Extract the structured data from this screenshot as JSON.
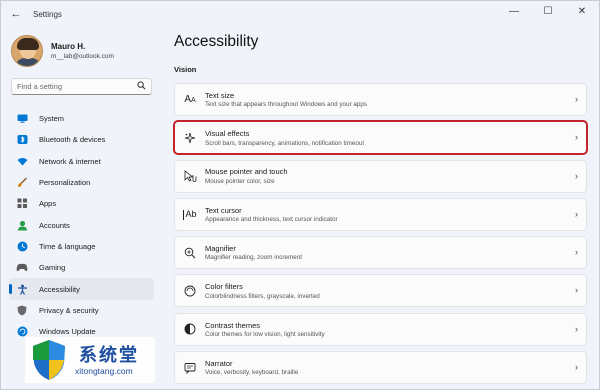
{
  "window": {
    "title": "Settings",
    "controls": [
      "minimize",
      "maximize",
      "close"
    ]
  },
  "profile": {
    "name": "Mauro H.",
    "email": "m__lab@outlook.com"
  },
  "search": {
    "placeholder": "Find a setting"
  },
  "sidebar": {
    "items": [
      {
        "label": "System",
        "icon": "system-icon",
        "color": "#0078d4",
        "active": false
      },
      {
        "label": "Bluetooth & devices",
        "icon": "bluetooth-icon",
        "color": "#0078d4",
        "active": false
      },
      {
        "label": "Network & internet",
        "icon": "network-icon",
        "color": "#0078d4",
        "active": false
      },
      {
        "label": "Personalization",
        "icon": "brush-icon",
        "color": "#d47a00",
        "active": false
      },
      {
        "label": "Apps",
        "icon": "apps-icon",
        "color": "#5b5b5b",
        "active": false
      },
      {
        "label": "Accounts",
        "icon": "accounts-icon",
        "color": "#2a9d4a",
        "active": false
      },
      {
        "label": "Time & language",
        "icon": "globe-clock-icon",
        "color": "#0078d4",
        "active": false
      },
      {
        "label": "Gaming",
        "icon": "gaming-icon",
        "color": "#5b5b5b",
        "active": false
      },
      {
        "label": "Accessibility",
        "icon": "accessibility-icon",
        "color": "#1a1a1a",
        "active": true
      },
      {
        "label": "Privacy & security",
        "icon": "shield-icon",
        "color": "#5b5b5b",
        "active": false
      },
      {
        "label": "Windows Update",
        "icon": "update-icon",
        "color": "#0078d4",
        "active": false
      }
    ]
  },
  "main": {
    "title": "Accessibility",
    "section": "Vision",
    "cards": [
      {
        "title": "Text size",
        "desc": "Text size that appears throughout Windows and your apps",
        "icon": "text-size-icon",
        "highlighted": false
      },
      {
        "title": "Visual effects",
        "desc": "Scroll bars, transparency, animations, notification timeout",
        "icon": "sparkle-icon",
        "highlighted": true
      },
      {
        "title": "Mouse pointer and touch",
        "desc": "Mouse pointer color, size",
        "icon": "pointer-icon",
        "highlighted": false
      },
      {
        "title": "Text cursor",
        "desc": "Appearance and thickness, text cursor indicator",
        "icon": "text-cursor-icon",
        "highlighted": false
      },
      {
        "title": "Magnifier",
        "desc": "Magnifier reading, zoom increment",
        "icon": "magnifier-icon",
        "highlighted": false
      },
      {
        "title": "Color filters",
        "desc": "Colorblindness filters, grayscale, inverted",
        "icon": "color-filter-icon",
        "highlighted": false
      },
      {
        "title": "Contrast themes",
        "desc": "Color themes for low vision, light sensitivity",
        "icon": "contrast-icon",
        "highlighted": false
      },
      {
        "title": "Narrator",
        "desc": "Voice, verbosity, keyboard, braille",
        "icon": "narrator-icon",
        "highlighted": false
      }
    ]
  },
  "watermark": {
    "brand": "系统堂",
    "site": "xitongtang.com"
  }
}
